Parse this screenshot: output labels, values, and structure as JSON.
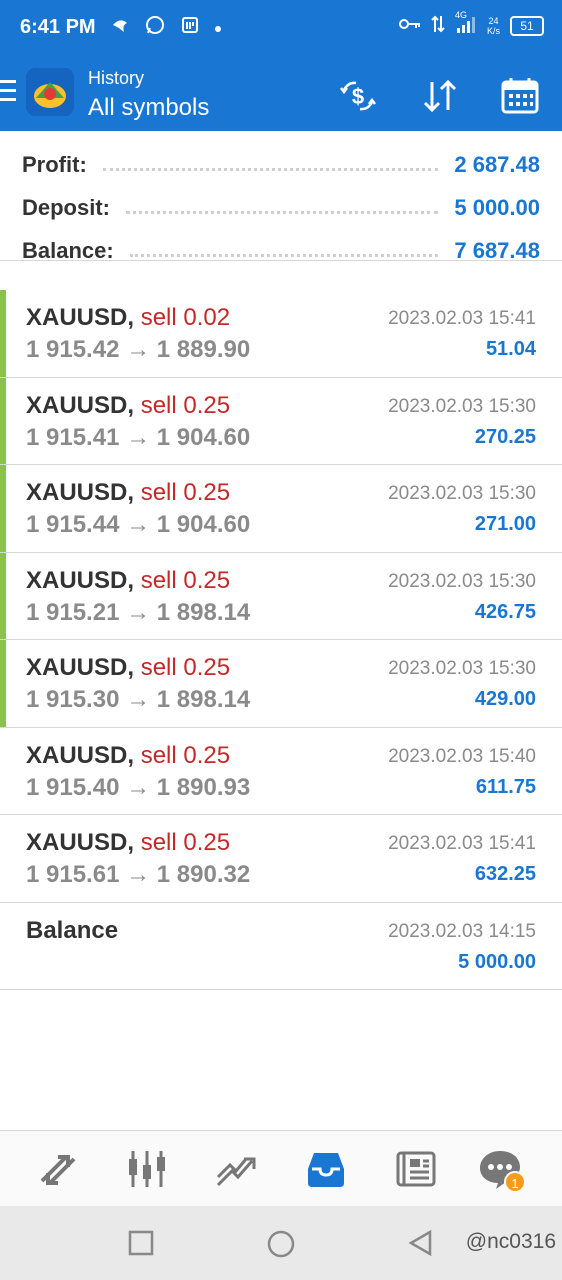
{
  "status_bar": {
    "time": "6:41 PM",
    "network": "4G",
    "speed_value": "24",
    "speed_unit": "K/s",
    "battery": "51"
  },
  "app_bar": {
    "subtitle": "History",
    "title": "All symbols",
    "icons": [
      "currency-exchange-icon",
      "sort-icon",
      "calendar-icon"
    ]
  },
  "summary": {
    "profit_label": "Profit:",
    "profit_value": "2 687.48",
    "deposit_label": "Deposit:",
    "deposit_value": "5 000.00",
    "balance_label": "Balance:",
    "balance_value": "7 687.48"
  },
  "deals": [
    {
      "symbol": "XAUUSD,",
      "side": "sell 0.02",
      "open_price": "1 915.42",
      "arrow": "→",
      "close_price": "1 889.90",
      "time": "2023.02.03 15:41",
      "profit": "51.04"
    },
    {
      "symbol": "XAUUSD,",
      "side": "sell 0.25",
      "open_price": "1 915.41",
      "arrow": "→",
      "close_price": "1 904.60",
      "time": "2023.02.03 15:30",
      "profit": "270.25"
    },
    {
      "symbol": "XAUUSD,",
      "side": "sell 0.25",
      "open_price": "1 915.44",
      "arrow": "→",
      "close_price": "1 904.60",
      "time": "2023.02.03 15:30",
      "profit": "271.00"
    },
    {
      "symbol": "XAUUSD,",
      "side": "sell 0.25",
      "open_price": "1 915.21",
      "arrow": "→",
      "close_price": "1 898.14",
      "time": "2023.02.03 15:30",
      "profit": "426.75"
    },
    {
      "symbol": "XAUUSD,",
      "side": "sell 0.25",
      "open_price": "1 915.30",
      "arrow": "→",
      "close_price": "1 898.14",
      "time": "2023.02.03 15:30",
      "profit": "429.00"
    },
    {
      "symbol": "XAUUSD,",
      "side": "sell 0.25",
      "open_price": "1 915.40",
      "arrow": "→",
      "close_price": "1 890.93",
      "time": "2023.02.03 15:40",
      "profit": "611.75"
    },
    {
      "symbol": "XAUUSD,",
      "side": "sell 0.25",
      "open_price": "1 915.61",
      "arrow": "→",
      "close_price": "1 890.32",
      "time": "2023.02.03 15:41",
      "profit": "632.25"
    }
  ],
  "balance_entry": {
    "label": "Balance",
    "time": "2023.02.03 14:15",
    "amount": "5 000.00"
  },
  "bottom_nav": {
    "items": [
      "quotes-icon",
      "chart-icon",
      "trade-icon",
      "history-icon",
      "news-icon",
      "messages-icon"
    ],
    "active": "history-icon",
    "messages_badge": "1"
  },
  "watermark": "@nc0316",
  "colors": {
    "primary": "#1976d2",
    "sell": "#c62828",
    "profit": "#1976d2",
    "marker": "#8bc34a",
    "badge": "#f59c1a"
  }
}
